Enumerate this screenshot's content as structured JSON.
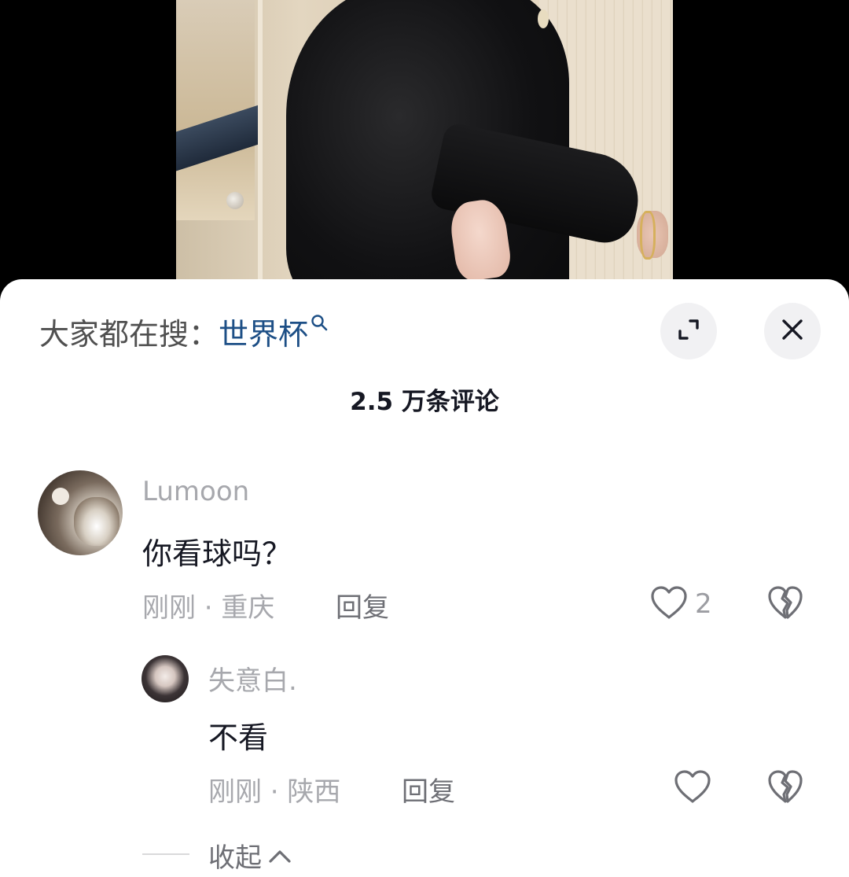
{
  "header": {
    "search_prefix": "大家都在搜：",
    "search_term": "世界杯",
    "comment_count": "2.5 万条评论"
  },
  "icons": {
    "search": "search-icon",
    "expand": "expand-icon",
    "close": "close-icon",
    "like": "heart-outline-icon",
    "dislike": "broken-heart-icon",
    "collapse": "chevron-up-icon"
  },
  "comments": [
    {
      "username": "Lumoon",
      "text": "你看球吗？",
      "meta": "刚刚 · 重庆",
      "reply_label": "回复",
      "likes": "2",
      "replies": [
        {
          "username": "失意白.",
          "text": "不看",
          "meta": "刚刚 · 陕西",
          "reply_label": "回复",
          "likes": ""
        }
      ],
      "collapse_label": "收起"
    }
  ],
  "colors": {
    "search_term": "#1d4f86",
    "primary_text": "#161823",
    "secondary_text": "#a7a8ad",
    "sheet_background": "#ffffff",
    "button_background": "#f1f1f3"
  }
}
